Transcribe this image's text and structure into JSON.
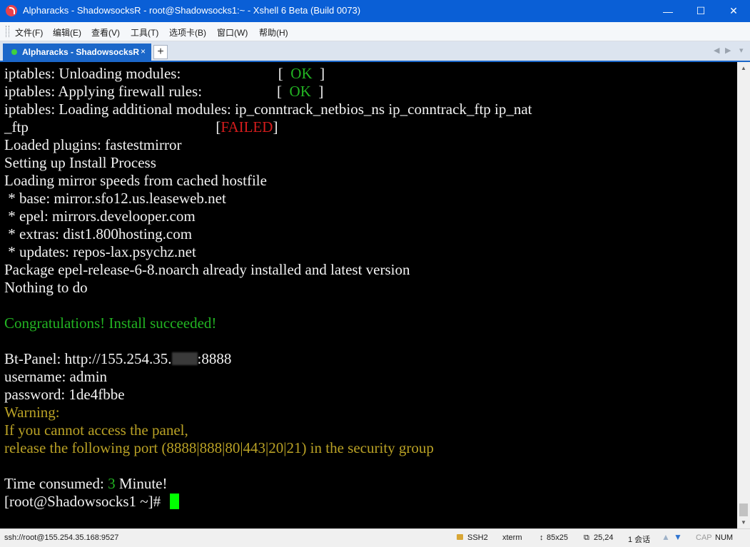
{
  "window": {
    "title": "Alpharacks - ShadowsocksR - root@Shadowsocks1:~ - Xshell 6 Beta (Build 0073)",
    "controls": {
      "minimize": "—",
      "maximize": "☐",
      "close": "✕"
    }
  },
  "menu": [
    {
      "label": "文件(F)"
    },
    {
      "label": "编辑(E)"
    },
    {
      "label": "查看(V)"
    },
    {
      "label": "工具(T)"
    },
    {
      "label": "选项卡(B)"
    },
    {
      "label": "窗口(W)"
    },
    {
      "label": "帮助(H)"
    }
  ],
  "tabs": {
    "active_label": "Alpharacks - ShadowsocksR",
    "close_glyph": "×",
    "add_glyph": "+",
    "nav_prev": "◀",
    "nav_next": "▶",
    "nav_menu": "▾"
  },
  "terminal": {
    "lines": [
      {
        "a": "iptables: Unloading modules:                          [  ",
        "b": "OK",
        "c": "  ]"
      },
      {
        "a": "iptables: Applying firewall rules:                    [  ",
        "b": "OK",
        "c": "  ]"
      },
      {
        "text": "iptables: Loading additional modules: ip_conntrack_netbios_ns ip_conntrack_ftp ip_nat"
      },
      {
        "a": "_ftp                                                  [",
        "b": "FAILED",
        "c": "]"
      },
      {
        "text": "Loaded plugins: fastestmirror"
      },
      {
        "text": "Setting up Install Process"
      },
      {
        "text": "Loading mirror speeds from cached hostfile"
      },
      {
        "text": " * base: mirror.sfo12.us.leaseweb.net"
      },
      {
        "text": " * epel: mirrors.develooper.com"
      },
      {
        "text": " * extras: dist1.800hosting.com"
      },
      {
        "text": " * updates: repos-lax.psychz.net"
      },
      {
        "text": "Package epel-release-6-8.noarch already installed and latest version"
      },
      {
        "text": "Nothing to do"
      },
      {
        "text": "=================================================================="
      },
      {
        "text": "Congratulations! Install succeeded!"
      },
      {
        "text": "=================================================================="
      },
      {
        "a": "Bt-Panel: http://155.254.35.",
        "c": ":8888"
      },
      {
        "text": "username: admin"
      },
      {
        "text": "password: 1de4fbbe"
      },
      {
        "text": "Warning:"
      },
      {
        "text": "If you cannot access the panel,"
      },
      {
        "text": "release the following port (8888|888|80|443|20|21) in the security group"
      },
      {
        "text": "=================================================================="
      },
      {
        "a": "Time consumed: ",
        "b": "3",
        "c": " Minute!"
      },
      {
        "text": "[root@Shadowsocks1 ~]# "
      }
    ]
  },
  "scrollbar": {
    "up": "▲",
    "down": "▼"
  },
  "status": {
    "connection": "ssh://root@155.254.35.168:9527",
    "protocol": "SSH2",
    "term": "xterm",
    "size_glyph": "↕",
    "size": "85x25",
    "pos_glyph": "⧉",
    "cursor_pos": "25,24",
    "sessions": "1 会话",
    "cap": "CAP",
    "num": "NUM"
  }
}
